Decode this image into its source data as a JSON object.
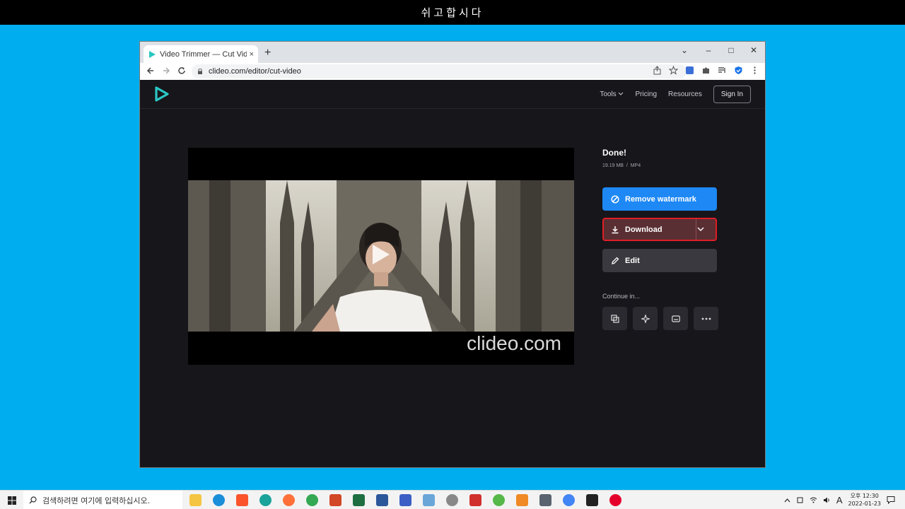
{
  "top_banner": {
    "text": "쉬고합시다"
  },
  "browser": {
    "tab_title": "Video Trimmer — Cut Video Or",
    "tab_close": "×",
    "new_tab": "+",
    "window_controls": {
      "dropdown": "⌄",
      "minimize": "–",
      "maximize": "□",
      "close": "✕"
    },
    "url": "clideo.com/editor/cut-video"
  },
  "site": {
    "nav": {
      "tools": "Tools",
      "pricing": "Pricing",
      "resources": "Resources",
      "sign_in": "Sign In"
    },
    "video": {
      "watermark": "clideo.com"
    },
    "panel": {
      "status": "Done!",
      "file_size": "19.19 MB",
      "separator": "/",
      "format": "MP4",
      "remove_watermark": "Remove watermark",
      "download": "Download",
      "edit": "Edit",
      "continue_in": "Continue in..."
    },
    "colors": {
      "accent_blue": "#1e88f5",
      "download_highlight": "#e01d24",
      "brand_teal": "#2ac7c3"
    }
  },
  "taskbar": {
    "search_placeholder": "검색하려면 여기에 입력하십시오.",
    "ime": "A",
    "ampm_time": "오후 12:30",
    "date": "2022-01-23"
  }
}
